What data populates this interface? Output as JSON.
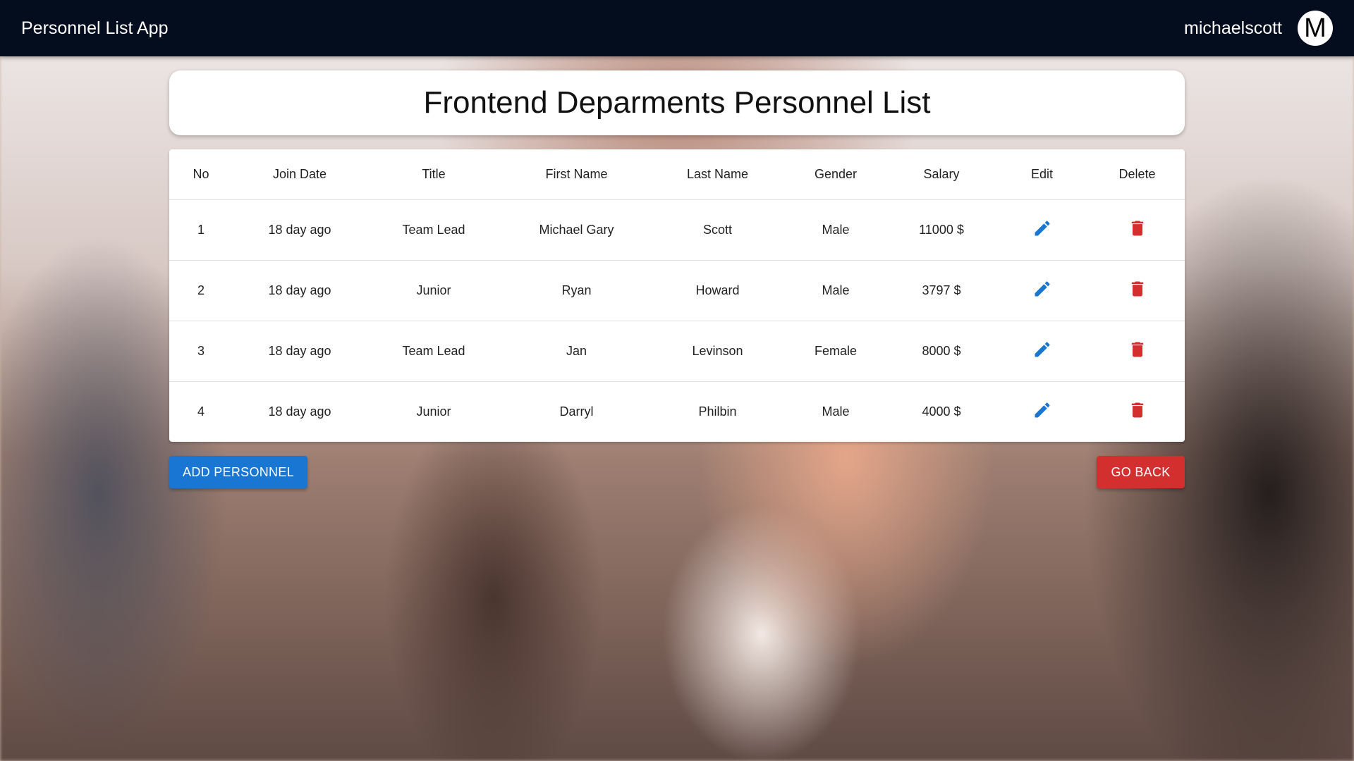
{
  "app": {
    "title": "Personnel List App",
    "username": "michaelscott",
    "avatar_letter": "M"
  },
  "page": {
    "title": "Frontend Deparments Personnel List"
  },
  "table": {
    "headers": [
      "No",
      "Join Date",
      "Title",
      "First Name",
      "Last Name",
      "Gender",
      "Salary",
      "Edit",
      "Delete"
    ],
    "rows": [
      {
        "no": "1",
        "join_date": "18 day ago",
        "title": "Team Lead",
        "first_name": "Michael Gary",
        "last_name": "Scott",
        "gender": "Male",
        "salary": "11000 $"
      },
      {
        "no": "2",
        "join_date": "18 day ago",
        "title": "Junior",
        "first_name": "Ryan",
        "last_name": "Howard",
        "gender": "Male",
        "salary": "3797 $"
      },
      {
        "no": "3",
        "join_date": "18 day ago",
        "title": "Team Lead",
        "first_name": "Jan",
        "last_name": "Levinson",
        "gender": "Female",
        "salary": "8000 $"
      },
      {
        "no": "4",
        "join_date": "18 day ago",
        "title": "Junior",
        "first_name": "Darryl",
        "last_name": "Philbin",
        "gender": "Male",
        "salary": "4000 $"
      }
    ]
  },
  "actions": {
    "add_label": "ADD PERSONNEL",
    "back_label": "GO BACK"
  },
  "icons": {
    "edit": "pencil-icon",
    "delete": "trash-icon"
  },
  "colors": {
    "appbar": "#040d1e",
    "primary": "#1976d2",
    "danger": "#d32f2f"
  }
}
